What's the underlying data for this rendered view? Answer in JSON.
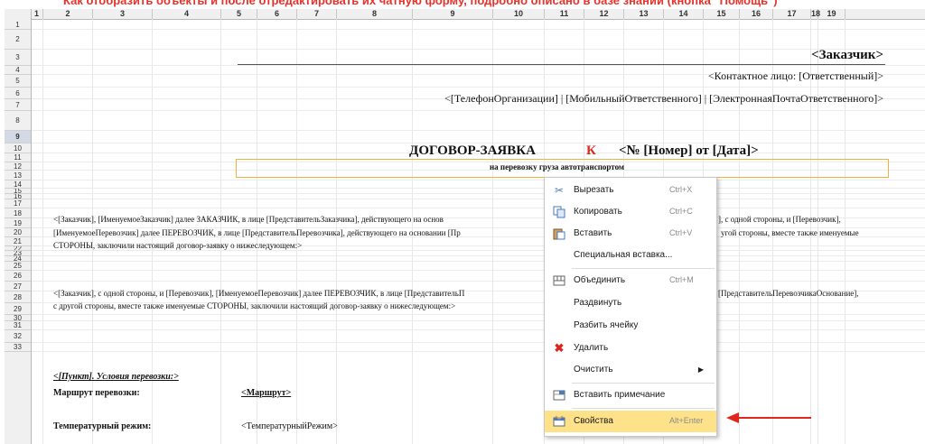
{
  "banner": {
    "text": "Как отобразить объекты и после отредактировать их чатную форму, подробно описано в базе знаний (кнопка \"Помощь\")"
  },
  "columns": [
    "1",
    "2",
    "3",
    "4",
    "5",
    "6",
    "7",
    "8",
    "9",
    "10",
    "11",
    "12",
    "13",
    "14",
    "15",
    "16",
    "17",
    "18",
    "19"
  ],
  "rows": [
    "1",
    "2",
    "3",
    "4",
    "5",
    "6",
    "7",
    "8",
    "9",
    "10",
    "11",
    "12",
    "13",
    "14",
    "15",
    "16",
    "17",
    "18",
    "19",
    "20",
    "21",
    "22",
    "23",
    "24",
    "25",
    "26",
    "27",
    "28",
    "29",
    "30",
    "31",
    "32",
    "33"
  ],
  "sheet": {
    "customer": "<Заказчик>",
    "contact": "<Контактное лицо: [Ответственный]>",
    "phones": "<[ТелефонОрганизации] | [МобильныйОтветственного] | [ЭлектроннаяПочтаОтветственного]>",
    "contract_title": "ДОГОВОР-ЗАЯВКА",
    "contract_k": "К",
    "contract_num": "<№ [Номер] от [Дата]>",
    "subtitle": "на перевозку груза автотранспортом",
    "p1_l1a": "<[Заказчик], [ИменуемоеЗаказчик] далее ЗАКАЗЧИК, в лице [ПредставительЗаказчика], действующего на основ",
    "p1_l1b": "], с одной стороны, и [Перевозчик],",
    "p1_l2a": "[ИменуемоеПеревозчик] далее ПЕРЕВОЗЧИК, в лице [ПредставительПеревозчика], действующего на основании [Пр",
    "p1_l2b": "угой стороны, вместе также именуемые",
    "p1_l3": "СТОРОНЫ, заключили настоящий договор-заявку о нижеследующем:>",
    "p2_l1a": "<[Заказчик], с одной стороны, и [Перевозчик], [ИменуемоеПеревозчик] далее ПЕРЕВОЗЧИК, в лице [ПредставительП",
    "p2_l1b": "[ПредставительПеревозчикаОснование],",
    "p2_l2": "с другой стороны, вместе также именуемые СТОРОНЫ, заключили настоящий договор-заявку о нижеследующем:>",
    "section_title": "<[Пункт]. Условия перевозки:>",
    "route_label": "Маршрут перевозки:",
    "route_value": "<Маршрут>",
    "temp_label": "Температурный режим:",
    "temp_value": "<ТемпературныйРежим>"
  },
  "context_menu": {
    "items": [
      {
        "label": "Вырезать",
        "shortcut": "Ctrl+X",
        "icon": "scissors-icon"
      },
      {
        "label": "Копировать",
        "shortcut": "Ctrl+C",
        "icon": "copy-icon"
      },
      {
        "label": "Вставить",
        "shortcut": "Ctrl+V",
        "icon": "paste-icon"
      },
      {
        "label": "Специальная вставка...",
        "shortcut": "",
        "icon": ""
      },
      {
        "label": "Объединить",
        "shortcut": "Ctrl+M",
        "icon": "merge-cells-icon"
      },
      {
        "label": "Раздвинуть",
        "shortcut": "",
        "icon": ""
      },
      {
        "label": "Разбить ячейку",
        "shortcut": "",
        "icon": ""
      },
      {
        "label": "Удалить",
        "shortcut": "",
        "icon": "delete-x-icon"
      },
      {
        "label": "Очистить",
        "shortcut": "",
        "icon": ""
      },
      {
        "label": "Вставить примечание",
        "shortcut": "",
        "icon": "comment-icon"
      },
      {
        "label": "Свойства",
        "shortcut": "Alt+Enter",
        "icon": "properties-icon"
      }
    ]
  },
  "colors": {
    "highlight": "#fde28a",
    "selected_cell_border": "#f0b43c",
    "red_k": "#e0251d",
    "arrow": "#e0251d"
  }
}
